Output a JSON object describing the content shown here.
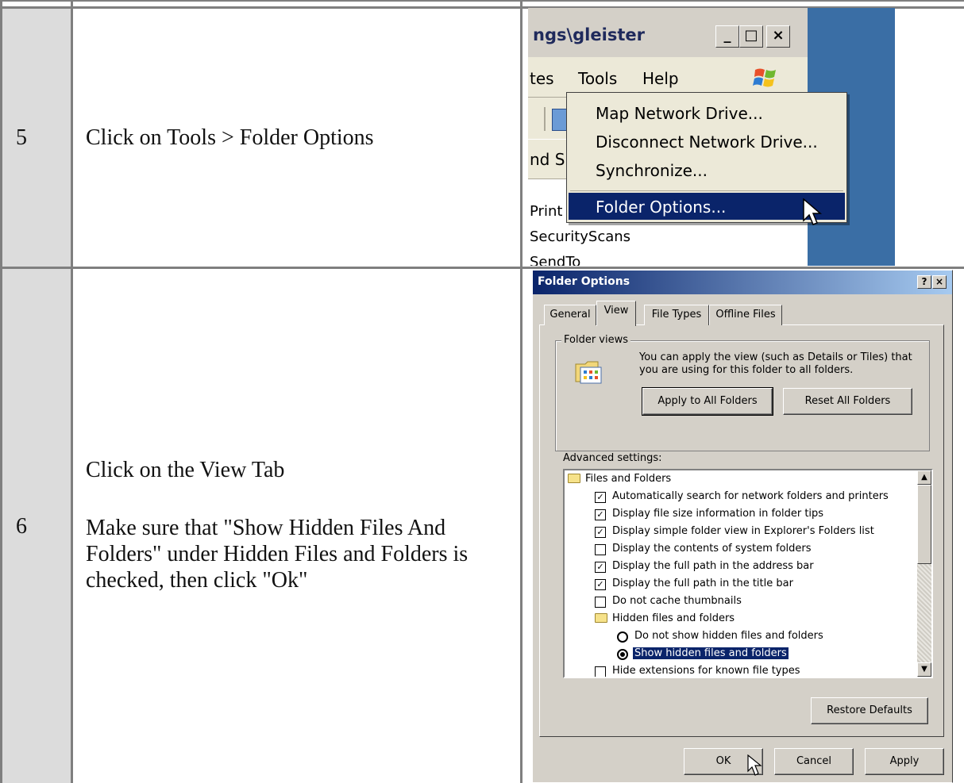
{
  "rows": [
    {
      "number": "5",
      "instruction": "Click on Tools > Folder Options"
    },
    {
      "number": "6",
      "instruction_line1": "Click on the View Tab",
      "instruction_line2": "Make sure that \"Show Hidden Files And Folders\" under Hidden Files and Folders is checked, then click \"Ok\""
    }
  ],
  "explorer": {
    "title": "ngs\\gleister",
    "window_buttons": [
      "_",
      "□",
      "×"
    ],
    "menu": [
      "tes",
      "Tools",
      "Help"
    ],
    "address_fragment": "nd S",
    "file_items": [
      "Print",
      "SecurityScans",
      "SendTo"
    ],
    "tools_menu": [
      "Map Network Drive...",
      "Disconnect Network Drive...",
      "Synchronize...",
      "Folder Options..."
    ]
  },
  "folder_options": {
    "title": "Folder Options",
    "title_buttons": [
      "?",
      "×"
    ],
    "tabs": [
      "General",
      "View",
      "File Types",
      "Offline Files"
    ],
    "folder_views": {
      "label": "Folder views",
      "description": "You can apply the view (such as Details or Tiles) that you are using for this folder to all folders.",
      "apply_button": "Apply to All Folders",
      "reset_button": "Reset All Folders"
    },
    "advanced_label": "Advanced settings:",
    "settings": [
      {
        "type": "folder",
        "label": "Files and Folders"
      },
      {
        "type": "check",
        "checked": true,
        "label": "Automatically search for network folders and printers"
      },
      {
        "type": "check",
        "checked": true,
        "label": "Display file size information in folder tips"
      },
      {
        "type": "check",
        "checked": true,
        "label": "Display simple folder view in Explorer's Folders list"
      },
      {
        "type": "check",
        "checked": false,
        "label": "Display the contents of system folders"
      },
      {
        "type": "check",
        "checked": true,
        "label": "Display the full path in the address bar"
      },
      {
        "type": "check",
        "checked": true,
        "label": "Display the full path in the title bar"
      },
      {
        "type": "check",
        "checked": false,
        "label": "Do not cache thumbnails"
      },
      {
        "type": "folder",
        "label": "Hidden files and folders"
      },
      {
        "type": "radio",
        "checked": false,
        "label": "Do not show hidden files and folders"
      },
      {
        "type": "radio",
        "checked": true,
        "label": "Show hidden files and folders"
      },
      {
        "type": "check",
        "checked": false,
        "label": "Hide extensions for known file types"
      }
    ],
    "restore_button": "Restore Defaults",
    "ok_button": "OK",
    "cancel_button": "Cancel",
    "apply_button": "Apply"
  }
}
